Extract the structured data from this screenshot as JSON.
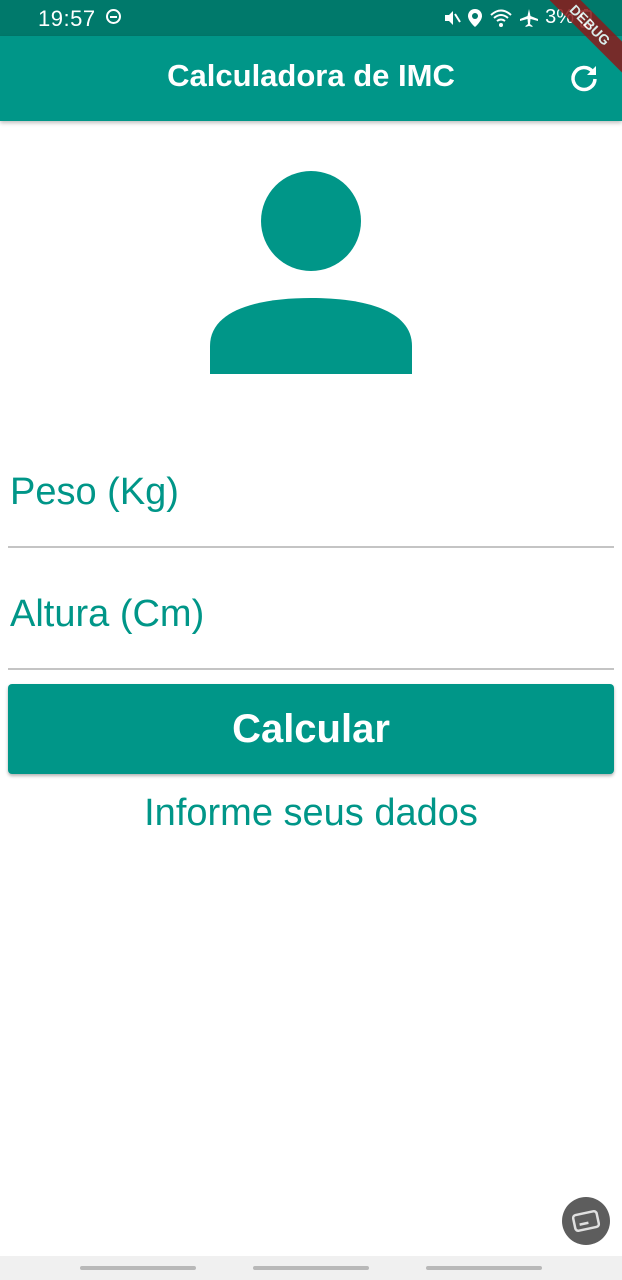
{
  "status_bar": {
    "time": "19:57",
    "battery": "3%",
    "icons": [
      "do-not-disturb-icon",
      "mute-icon",
      "location-icon",
      "wifi-icon",
      "airplane-icon",
      "battery-icon"
    ]
  },
  "app_bar": {
    "title": "Calculadora de IMC",
    "action_icon": "refresh-icon",
    "debug_banner": "DEBUG"
  },
  "avatar_icon": "person-icon",
  "form": {
    "weight_label": "Peso (Kg)",
    "height_label": "Altura (Cm)",
    "calculate_button": "Calcular",
    "info_text": "Informe seus dados"
  },
  "colors": {
    "primary": "#009688",
    "status_bar": "#00796b",
    "divider": "#c4c4c4"
  }
}
